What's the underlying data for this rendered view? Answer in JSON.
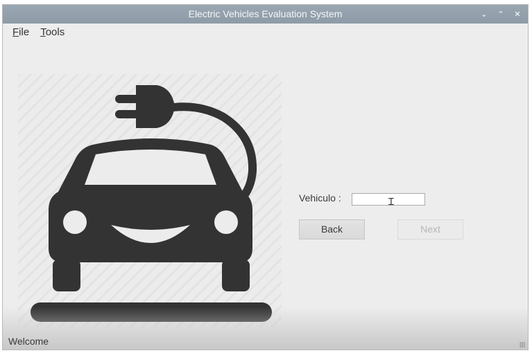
{
  "window": {
    "title": "Electric Vehicles Evaluation System",
    "controls": {
      "minimize": "⌄",
      "maximize": "⌃",
      "close": "✕"
    }
  },
  "menu": {
    "file": {
      "mnemonic": "F",
      "rest": "ile"
    },
    "tools": {
      "mnemonic": "T",
      "rest": "ools"
    }
  },
  "logo": {
    "icon": "electric-car-plug-icon",
    "color": "#333333"
  },
  "form": {
    "vehicle_label": "Vehiculo :",
    "vehicle_value": "",
    "back_label": "Back",
    "next_label": "Next",
    "next_enabled": false
  },
  "status": {
    "text": "Welcome"
  }
}
